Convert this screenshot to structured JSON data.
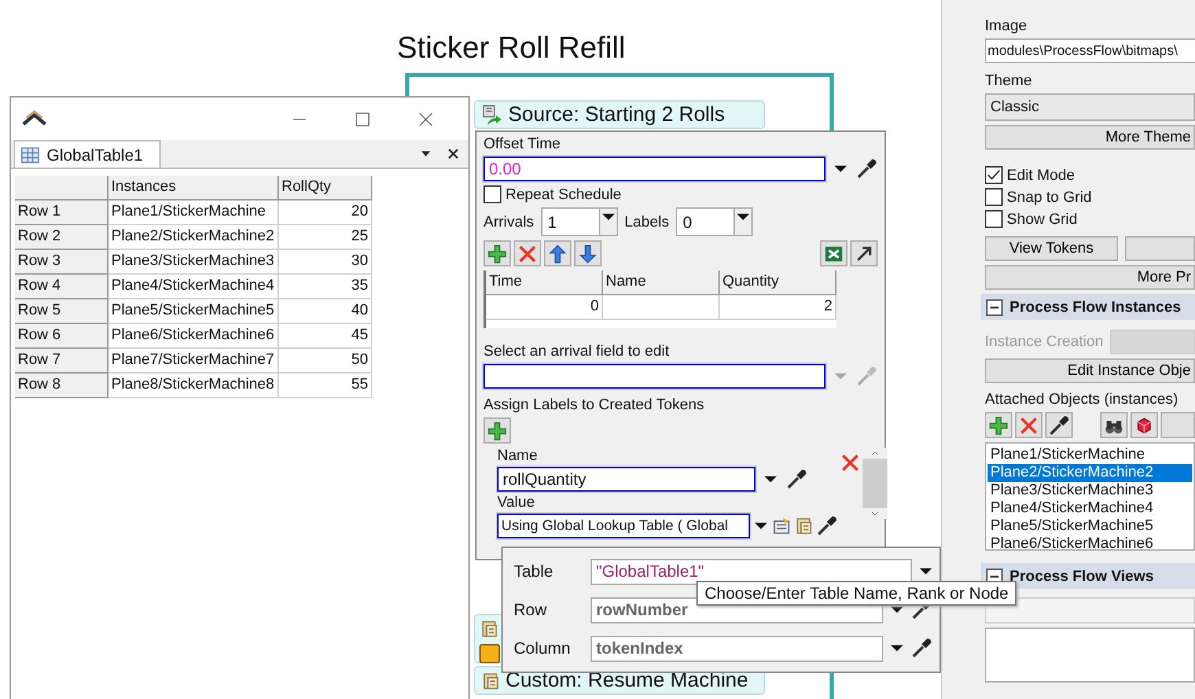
{
  "canvas": {
    "title": "Sticker Roll Refill",
    "blocks": [
      {
        "kind": "source",
        "label": "Source: Starting 2 Rolls"
      },
      {
        "kind": "custom",
        "label": "Custom: Resume Machine"
      }
    ]
  },
  "table_window": {
    "tab": "GlobalTable1",
    "columns": [
      "Instances",
      "RollQty"
    ],
    "rows": [
      {
        "header": "Row 1",
        "instance": "Plane1/StickerMachine",
        "qty": "20"
      },
      {
        "header": "Row 2",
        "instance": "Plane2/StickerMachine2",
        "qty": "25"
      },
      {
        "header": "Row 3",
        "instance": "Plane3/StickerMachine3",
        "qty": "30"
      },
      {
        "header": "Row 4",
        "instance": "Plane4/StickerMachine4",
        "qty": "35"
      },
      {
        "header": "Row 5",
        "instance": "Plane5/StickerMachine5",
        "qty": "40"
      },
      {
        "header": "Row 6",
        "instance": "Plane6/StickerMachine6",
        "qty": "45"
      },
      {
        "header": "Row 7",
        "instance": "Plane7/StickerMachine7",
        "qty": "50"
      },
      {
        "header": "Row 8",
        "instance": "Plane8/StickerMachine8",
        "qty": "55"
      }
    ]
  },
  "properties": {
    "offset_time": {
      "label": "Offset Time",
      "value": "0.00"
    },
    "repeat": {
      "label": "Repeat Schedule",
      "checked": false
    },
    "arrivals": {
      "label": "Arrivals",
      "value": "1"
    },
    "labels": {
      "label": "Labels",
      "value": "0"
    },
    "schedule": {
      "columns": [
        "Time",
        "Name",
        "Quantity"
      ],
      "rows": [
        {
          "time": "0",
          "quantity": "2"
        }
      ]
    },
    "arrival_field": {
      "label": "Select an arrival field to edit"
    },
    "assign_label": "Assign Labels to Created Tokens",
    "token_label": {
      "name_label": "Name",
      "name": "rollQuantity",
      "value_label": "Value",
      "value": "Using Global Lookup Table ( Global"
    }
  },
  "lookup": {
    "fields": [
      {
        "label": "Table",
        "value": "\"GlobalTable1\"",
        "kind": "string"
      },
      {
        "label": "Row",
        "value": "rowNumber",
        "kind": "code"
      },
      {
        "label": "Column",
        "value": "tokenIndex",
        "kind": "code"
      }
    ],
    "tooltip": "Choose/Enter Table Name, Rank or Node"
  },
  "sidebar": {
    "image": {
      "label": "Image",
      "value": "modules\\ProcessFlow\\bitmaps\\"
    },
    "theme": {
      "label": "Theme",
      "value": "Classic"
    },
    "more_themes": "More Theme",
    "options": [
      {
        "label": "Edit Mode",
        "checked": true
      },
      {
        "label": "Snap to Grid",
        "checked": false
      },
      {
        "label": "Show Grid",
        "checked": false
      }
    ],
    "view_tokens": "View Tokens",
    "more_properties": "More Pr",
    "instances_section": {
      "title": "Process Flow Instances",
      "expanded": true
    },
    "instance_creation": "Instance Creation",
    "edit_instance": "Edit Instance Obje",
    "attached_label": "Attached Objects (instances)",
    "attached": [
      {
        "label": "Plane1/StickerMachine",
        "selected": false
      },
      {
        "label": "Plane2/StickerMachine2",
        "selected": true
      },
      {
        "label": "Plane3/StickerMachine3",
        "selected": false
      },
      {
        "label": "Plane4/StickerMachine4",
        "selected": false
      },
      {
        "label": "Plane5/StickerMachine5",
        "selected": false
      },
      {
        "label": "Plane6/StickerMachine6",
        "selected": false
      }
    ],
    "views_section": {
      "title": "Process Flow Views",
      "expanded": true
    }
  }
}
